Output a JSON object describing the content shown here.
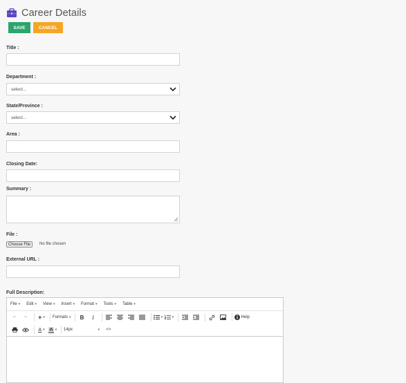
{
  "page": {
    "title": "Career Details"
  },
  "buttons": {
    "save": "SAVE",
    "cancel": "CANCEL"
  },
  "form": {
    "title_label": "Title :",
    "department_label": "Department :",
    "department_value": "select...",
    "state_label": "State/Province :",
    "state_value": "select...",
    "area_label": "Area :",
    "closing_date_label": "Closing Date:",
    "summary_label": "Summary :",
    "file_label": "File :",
    "file_button": "Choose File",
    "file_status": "No file chosen",
    "external_url_label": "External URL :",
    "full_description_label": "Full Description:"
  },
  "editor": {
    "menus": [
      "File",
      "Edit",
      "View",
      "Insert",
      "Format",
      "Tools",
      "Table"
    ],
    "formats": "Formats",
    "help": "Help",
    "font_size": "14px",
    "source_code": "<>"
  },
  "colors": {
    "save": "#2aa56d",
    "cancel": "#f5a623",
    "header_icon": "#6a4cc9"
  }
}
